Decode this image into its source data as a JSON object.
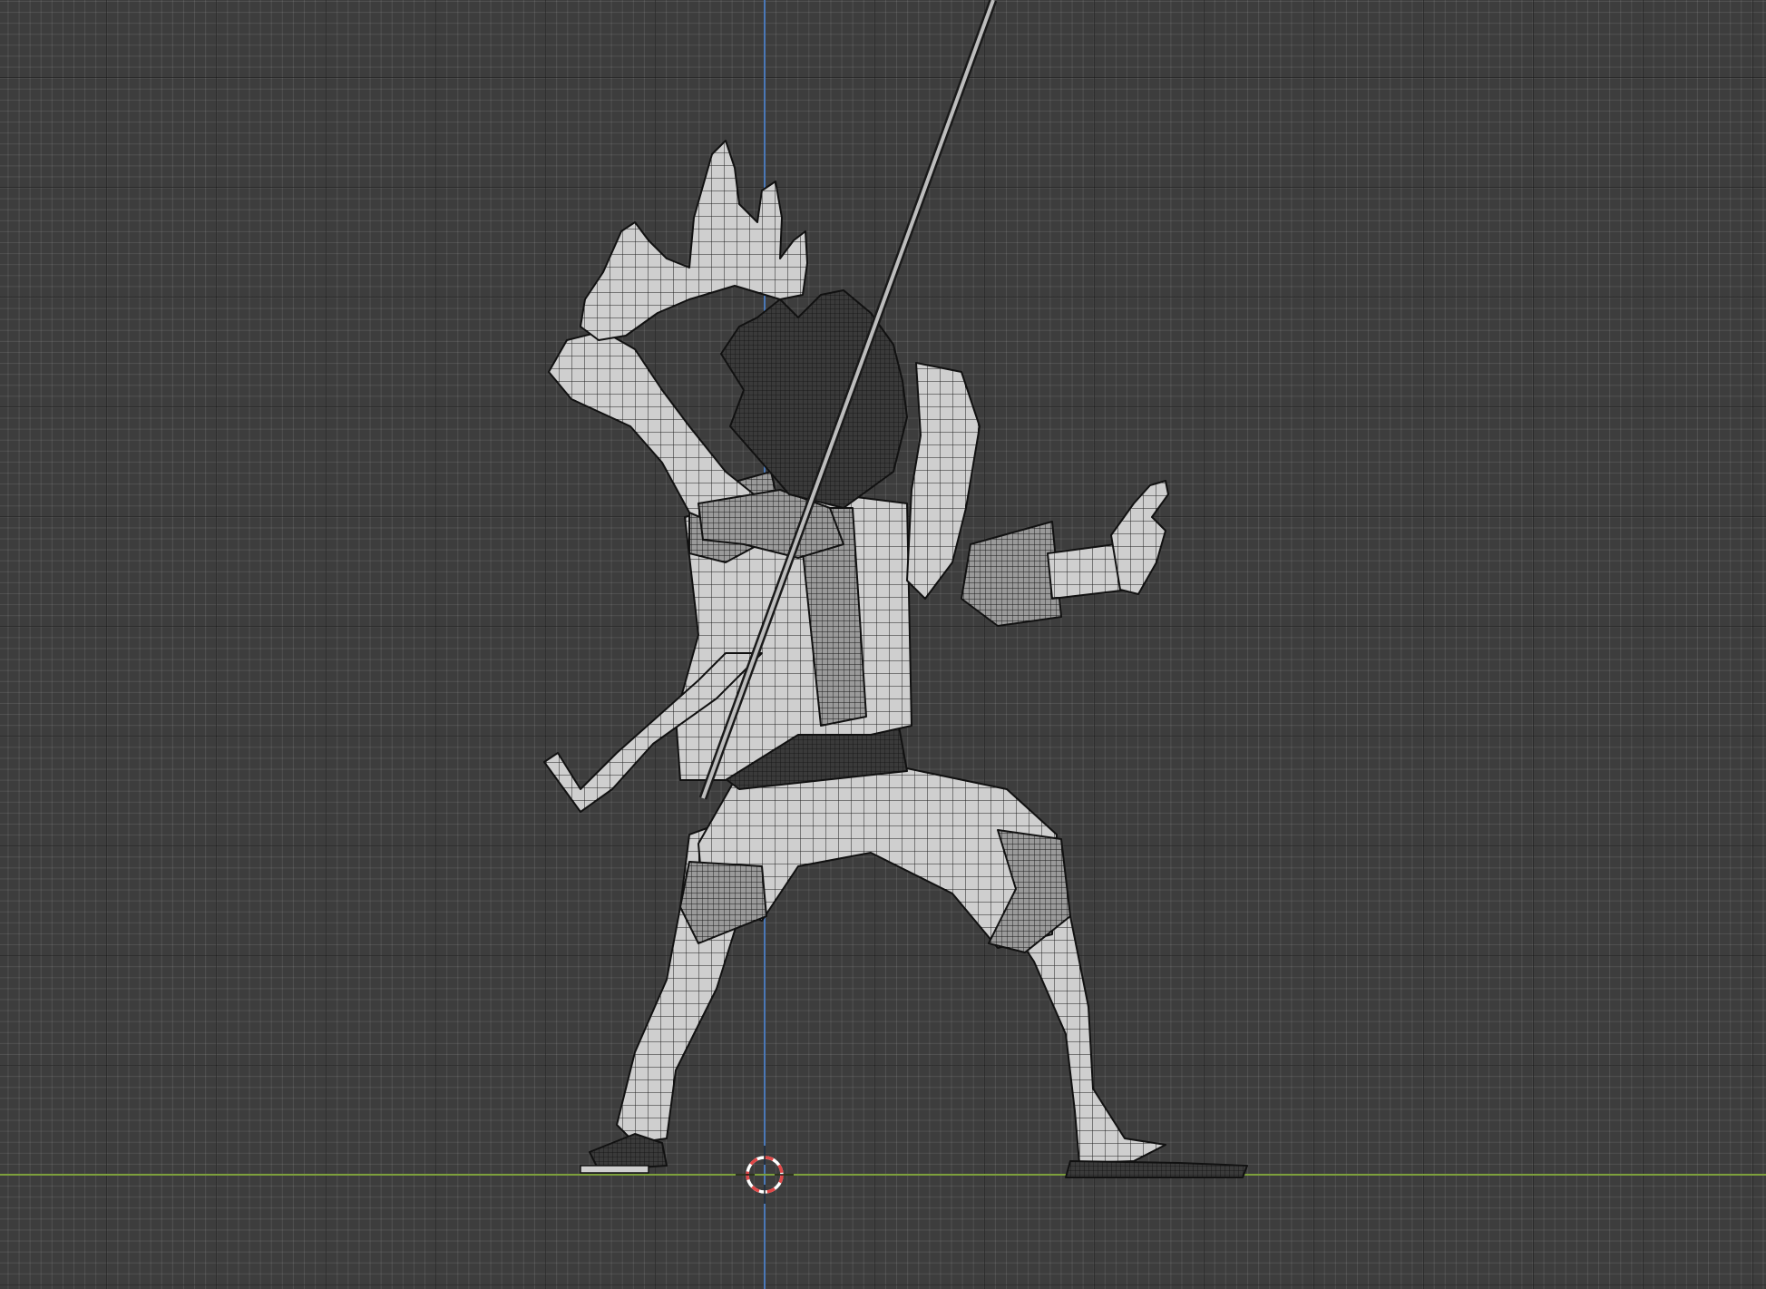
{
  "viewport": {
    "projection": "orthographic",
    "background_color": "#3d3d3d",
    "grid": true,
    "axis_colors": {
      "vertical": "#4a78b8",
      "horizontal": "#7da03c"
    },
    "cursor_colors": [
      "#e04848",
      "#ffffff"
    ],
    "model": {
      "shading": "solid-wireframe",
      "surface_color": "#cfcfcf",
      "wire_color": "#1a1a1a"
    }
  }
}
